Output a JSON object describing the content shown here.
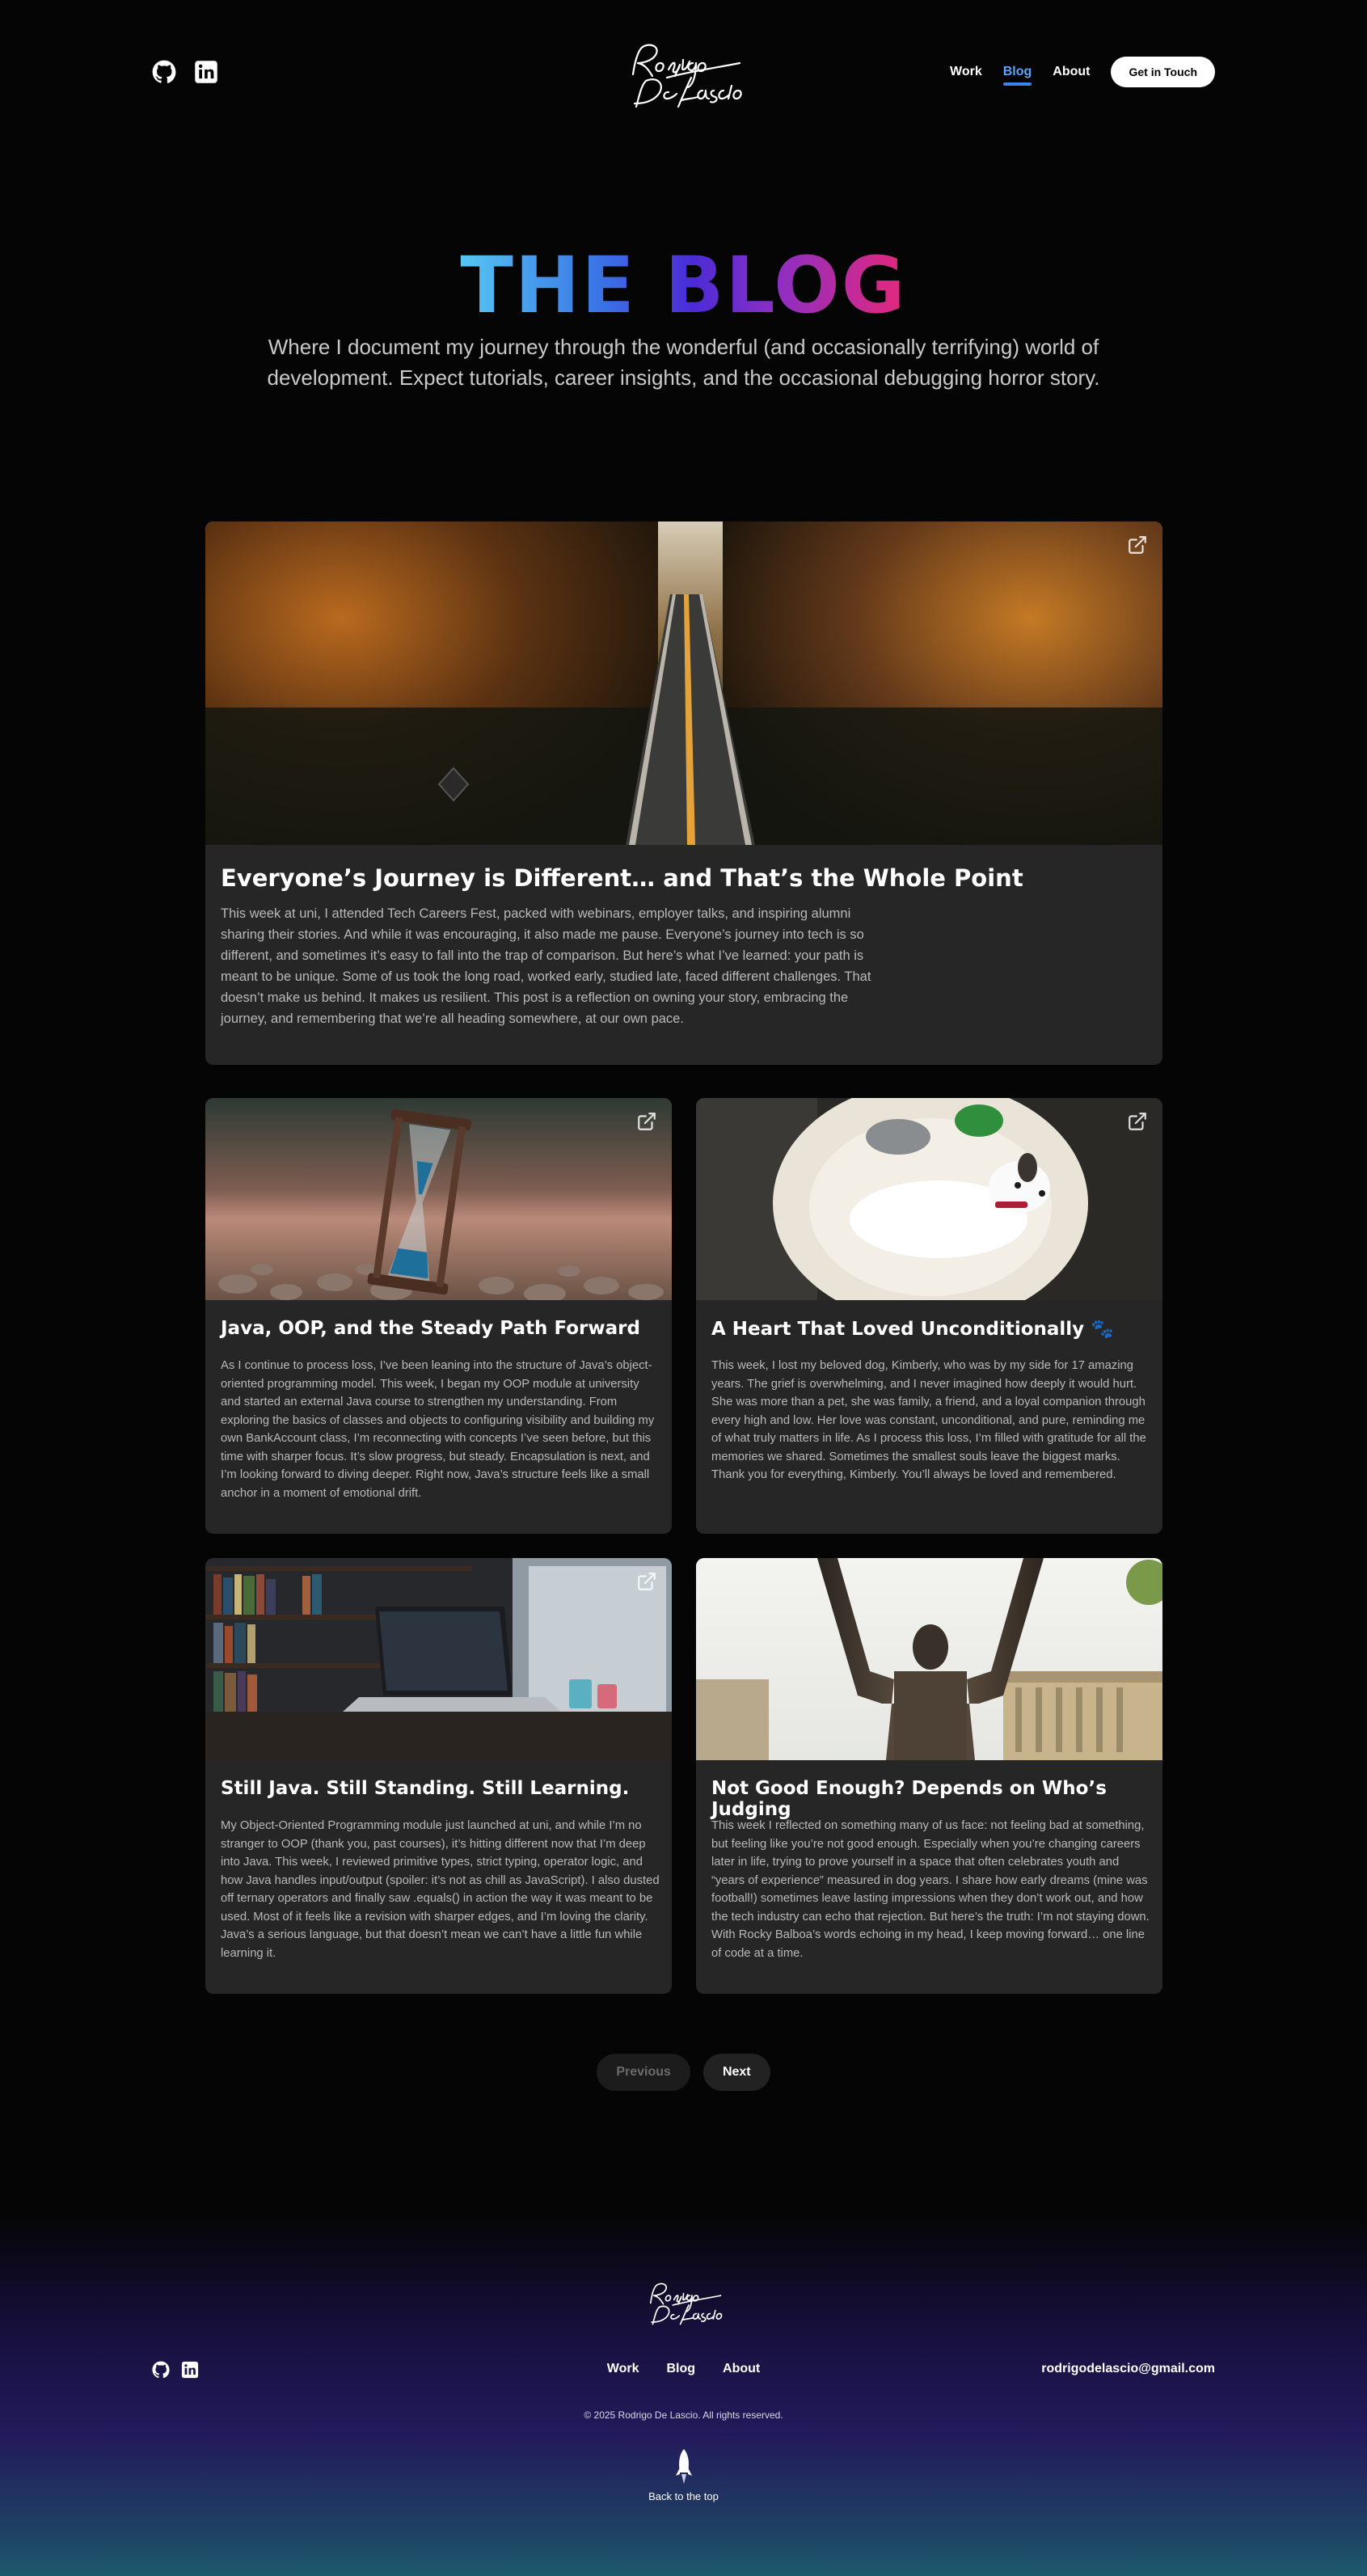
{
  "header": {
    "social": [
      {
        "icon": "github-icon"
      },
      {
        "icon": "linkedin-icon"
      }
    ],
    "logo_text": [
      "Rodrigo",
      "De Lascio"
    ],
    "nav": [
      {
        "label": "Work",
        "active": false
      },
      {
        "label": "Blog",
        "active": true
      },
      {
        "label": "About",
        "active": false
      }
    ],
    "cta_label": "Get in Touch"
  },
  "hero": {
    "title": "THE BLOG",
    "subtitle": "Where I document my journey through the wonderful (and occasionally terrifying) world of development. Expect tutorials, career insights, and the occasional debugging horror story."
  },
  "posts": [
    {
      "title": "Everyone’s Journey is Different… and That’s the Whole Point",
      "excerpt": "This week at uni, I attended Tech Careers Fest, packed with webinars, employer talks, and inspiring alumni sharing their stories. And while it was encouraging, it also made me pause. Everyone’s journey into tech is so different, and sometimes it’s easy to fall into the trap of comparison. But here’s what I’ve learned: your path is meant to be unique. Some of us took the long road, worked early, studied late, faced different challenges. That doesn’t make us behind. It makes us resilient. This post is a reflection on owning your story, embracing the journey, and remembering that we’re all heading somewhere, at our own pace.",
      "image": "winding road through autumn forest",
      "icon": "external-link-icon"
    },
    {
      "title": "Java, OOP, and the Steady Path Forward",
      "excerpt": "As I continue to process loss, I’ve been leaning into the structure of Java’s object-oriented programming model. This week, I began my OOP module at university and started an external Java course to strengthen my understanding. From exploring the basics of classes and objects to configuring visibility and building my own BankAccount class, I’m reconnecting with concepts I’ve seen before, but this time with sharper focus. It’s slow progress, but steady. Encapsulation is next, and I’m looking forward to diving deeper. Right now, Java’s structure feels like a small anchor in a moment of emotional drift.",
      "image": "hourglass on pebbles",
      "icon": "external-link-icon"
    },
    {
      "title": "A Heart That Loved Unconditionally 🐾",
      "excerpt": "This week, I lost my beloved dog, Kimberly, who was by my side for 17 amazing years. The grief is overwhelming, and I never imagined how deeply it would hurt. She was more than a pet, she was family, a friend, and a loyal companion through every high and low. Her love was constant, unconditional, and pure, reminding me of what truly matters in life. As I process this loss, I’m filled with gratitude for all the memories we shared. Sometimes the smallest souls leave the biggest marks. Thank you for everything, Kimberly. You’ll always be loved and remembered.",
      "image": "small white dog in round bed",
      "icon": "external-link-icon"
    },
    {
      "title": "Still Java. Still Standing. Still Learning.",
      "excerpt": "My Object-Oriented Programming module just launched at uni, and while I’m no stranger to OOP (thank you, past courses), it’s hitting different now that I’m deep into Java. This week, I reviewed primitive types, strict typing, operator logic, and how Java handles input/output (spoiler: it’s not as chill as JavaScript). I also dusted off ternary operators and finally saw .equals() in action the way it was meant to be used. Most of it feels like a revision with sharper edges, and I’m loving the clarity. Java’s a serious language, but that doesn’t mean we can’t have a little fun while learning it.",
      "image": "laptop on desk in front of bookshelf",
      "icon": "external-link-icon"
    },
    {
      "title": "Not Good Enough? Depends on Who’s Judging",
      "excerpt": "This week I reflected on something many of us face: not feeling bad at something, but feeling like you’re not good enough. Especially when you’re changing careers later in life, trying to prove yourself in a space that often celebrates youth and “years of experience” measured in dog years. I share how early dreams (mine was football!) sometimes leave lasting impressions when they don’t work out, and how the tech industry can echo that rejection. But here’s the truth: I’m not staying down. With Rocky Balboa’s words echoing in my head, I keep moving forward… one line of code at a time.",
      "image": "Rocky statue with raised arms",
      "icon": "external-link-icon"
    }
  ],
  "pagination": {
    "previous_label": "Previous",
    "next_label": "Next"
  },
  "footer": {
    "social": [
      {
        "icon": "github-icon"
      },
      {
        "icon": "linkedin-icon"
      }
    ],
    "nav": [
      "Work",
      "Blog",
      "About"
    ],
    "email": "rodrigodelascio@gmail.com",
    "copyright": "© 2025 Rodrigo De Lascio. All rights reserved.",
    "back_to_top": "Back to the top",
    "back_to_top_icon": "rocket-icon"
  },
  "colors": {
    "background": "#050505",
    "card": "#262626",
    "accent": "#3e82f0",
    "title_gradient": [
      "#56c6f2",
      "#3a72e6",
      "#4b2bd6",
      "#8a2fc6",
      "#e6287a"
    ]
  }
}
